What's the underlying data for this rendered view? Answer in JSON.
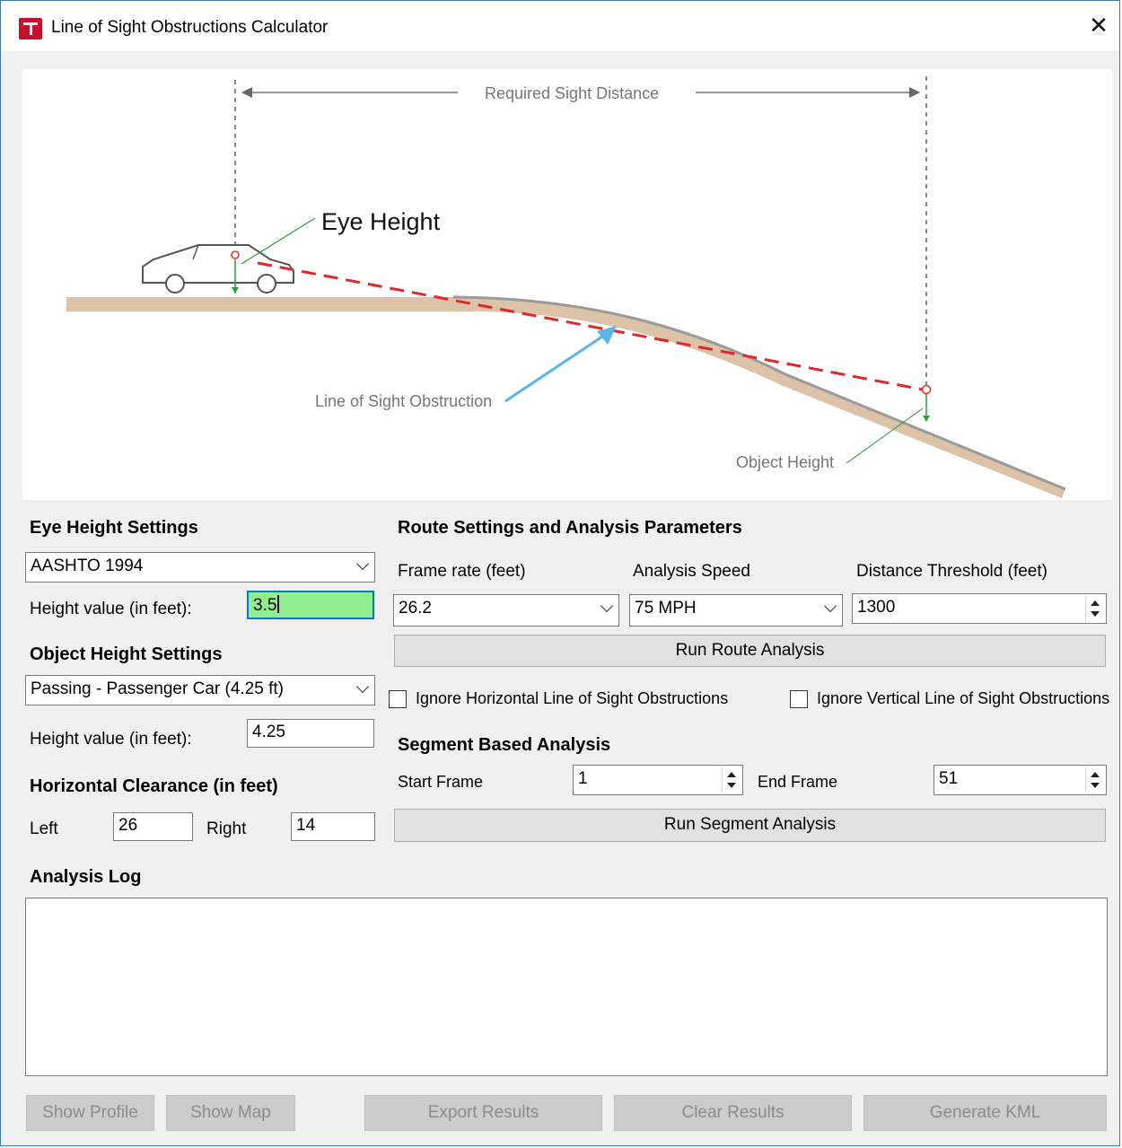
{
  "window": {
    "title": "Line of Sight Obstructions Calculator",
    "close_glyph": "✕"
  },
  "diagram": {
    "required_sight_distance": "Required Sight Distance",
    "eye_height": "Eye Height",
    "line_of_sight_obstruction": "Line of Sight Obstruction",
    "object_height": "Object Height"
  },
  "eye_height_settings": {
    "header": "Eye Height Settings",
    "standard": "AASHTO 1994",
    "height_label": "Height value (in feet):",
    "height_value": "3.5"
  },
  "object_height_settings": {
    "header": "Object Height Settings",
    "object": "Passing - Passenger Car (4.25 ft)",
    "height_label": "Height value (in feet):",
    "height_value": "4.25"
  },
  "horizontal_clearance": {
    "header": "Horizontal Clearance (in feet)",
    "left_label": "Left",
    "left_value": "26",
    "right_label": "Right",
    "right_value": "14"
  },
  "route_settings": {
    "header": "Route Settings and Analysis Parameters",
    "frame_rate_label": "Frame rate (feet)",
    "frame_rate_value": "26.2",
    "analysis_speed_label": "Analysis Speed",
    "analysis_speed_value": "75 MPH",
    "distance_threshold_label": "Distance Threshold (feet)",
    "distance_threshold_value": "1300",
    "run_route_button": "Run Route Analysis",
    "ignore_horizontal_label": "Ignore Horizontal Line of Sight Obstructions",
    "ignore_vertical_label": "Ignore Vertical Line of Sight Obstructions"
  },
  "segment_analysis": {
    "header": "Segment Based Analysis",
    "start_frame_label": "Start Frame",
    "start_frame_value": "1",
    "end_frame_label": "End Frame",
    "end_frame_value": "51",
    "run_segment_button": "Run Segment Analysis"
  },
  "analysis_log": {
    "header": "Analysis Log"
  },
  "bottom_buttons": {
    "show_profile": "Show Profile",
    "show_map": "Show Map",
    "export_results": "Export Results",
    "clear_results": "Clear Results",
    "generate_kml": "Generate KML"
  }
}
